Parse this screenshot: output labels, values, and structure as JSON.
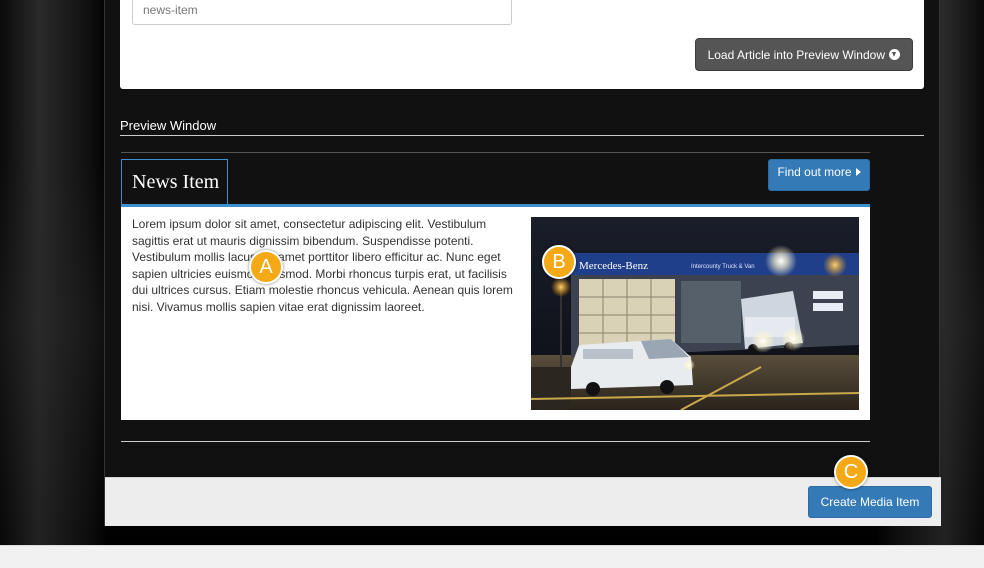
{
  "editor": {
    "key_value": "news-item",
    "load_button_label": "Load Article into Preview Window",
    "load_icon": "download-circle-icon"
  },
  "preview": {
    "section_label": "Preview Window",
    "tab_title": "News Item",
    "find_button_label": "Find out more",
    "find_icon": "caret-right-icon",
    "body_text": "Lorem ipsum dolor sit amet, consectetur adipiscing elit. Vestibulum sagittis erat ut mauris dignissim bibendum. Suspendisse potenti. Vestibulum mollis lacus, sit amet porttitor libero efficitur ac. Nunc eget sapien ultricies euismod euismod. Morbi rhoncus turpis erat, ut facilisis dui ultrices cursus. Etiam molestie rhoncus vehicula. Aenean quis lorem nisi. Vivamus mollis sapien vitae erat dignissim laoreet.",
    "photo": {
      "sign_text": "Mercedes-Benz",
      "sign_text_secondary": "Intercounty Truck & Van"
    }
  },
  "footer": {
    "create_button_label": "Create Media Item"
  },
  "callouts": [
    "A",
    "B",
    "C"
  ],
  "colors": {
    "accent_blue": "#337ab7",
    "callout_orange": "#f5a916",
    "dark_button": "#555555"
  }
}
